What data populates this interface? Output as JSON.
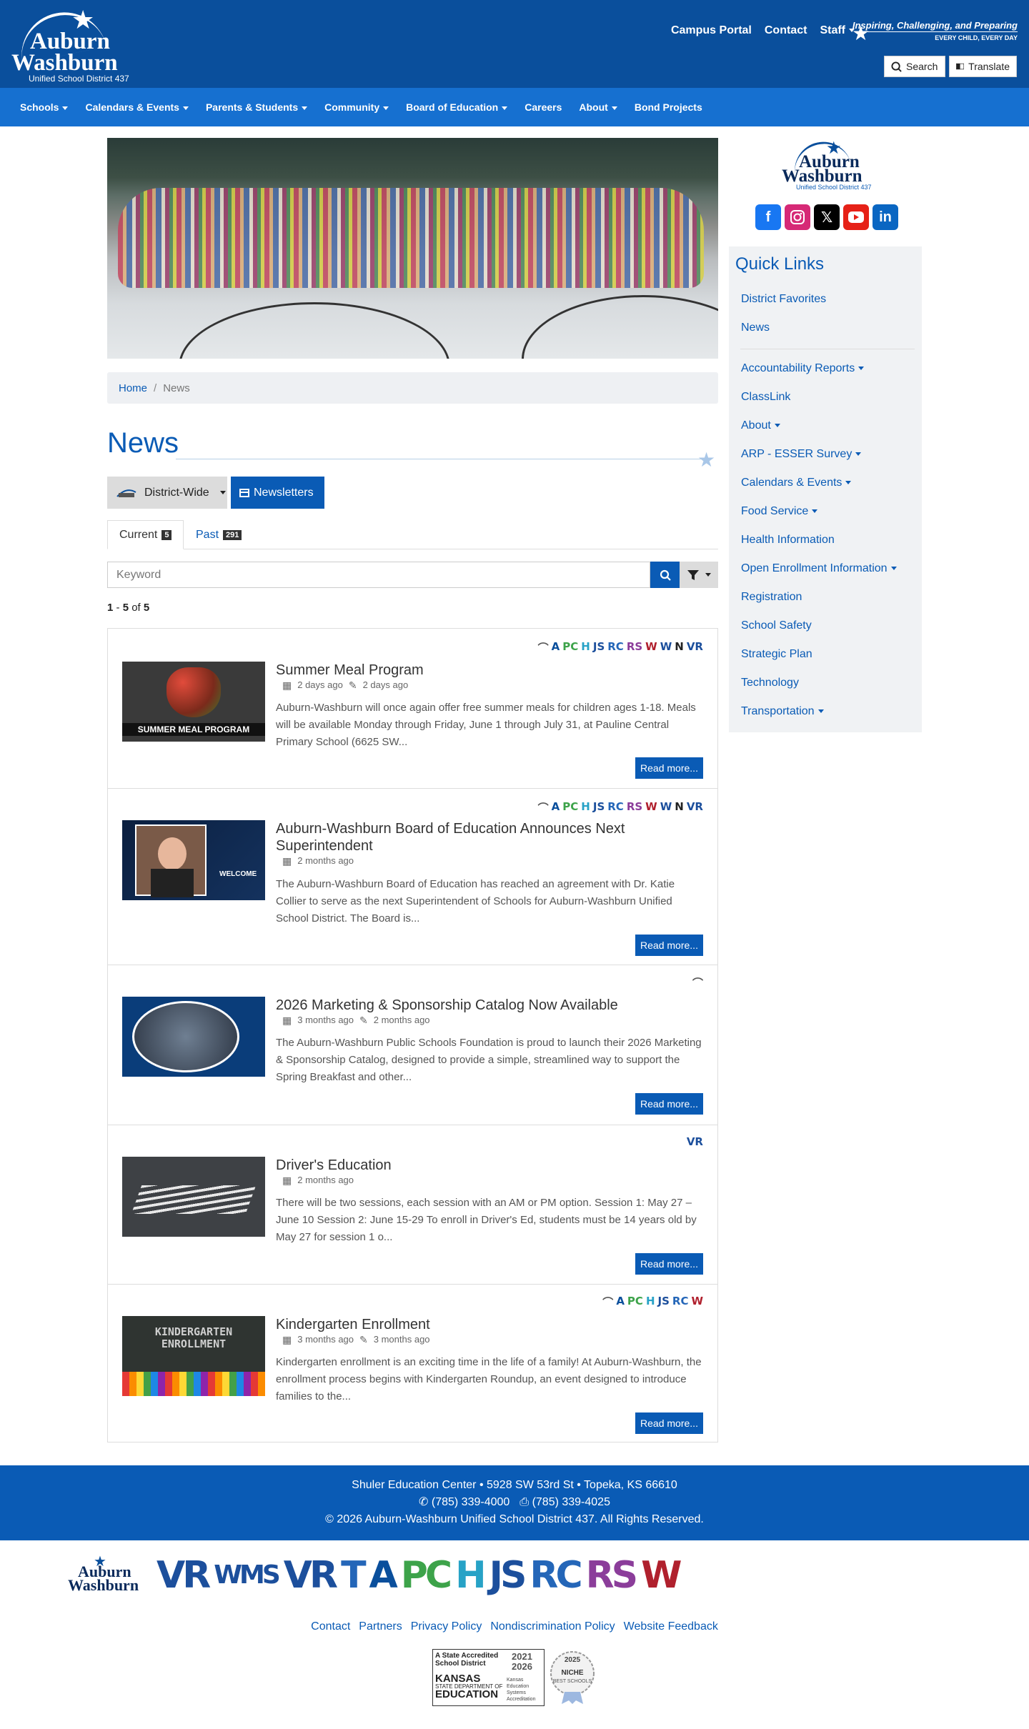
{
  "header": {
    "logo": {
      "line1": "Auburn",
      "line2": "Washburn",
      "line3": "Unified School District 437"
    },
    "top_links": [
      "Campus Portal",
      "Contact",
      "Staff"
    ],
    "tagline1": "Inspiring, Challenging, and Preparing",
    "tagline2": "EVERY CHILD, EVERY DAY",
    "search_label": "Search",
    "translate_label": "Translate"
  },
  "nav": [
    "Schools",
    "Calendars & Events",
    "Parents & Students",
    "Community",
    "Board of Education",
    "Careers",
    "About",
    "Bond Projects"
  ],
  "breadcrumb": {
    "home": "Home",
    "sep": "/",
    "current": "News"
  },
  "page_title": "News",
  "filter": {
    "district_label": "District-Wide",
    "newsletters_label": "Newsletters"
  },
  "tabs": {
    "current_label": "Current",
    "current_count": "5",
    "past_label": "Past",
    "past_count": "291"
  },
  "search": {
    "placeholder": "Keyword"
  },
  "results": {
    "from": "1",
    "dash": "-",
    "to": "5",
    "of": "of",
    "total": "5"
  },
  "articles": [
    {
      "title": "Summer Meal Program",
      "published": "2 days ago",
      "updated": "2 days ago",
      "excerpt": "Auburn-Washburn will once again offer free summer meals for children ages 1-18. Meals will be available Monday through Friday, June 1 through July 31, at Pauline Central Primary School (6625 SW...",
      "read_more": "Read more...",
      "thumb_caption": "SUMMER MEAL PROGRAM"
    },
    {
      "title": "Auburn-Washburn Board of Education Announces Next Superintendent",
      "published": "2 months ago",
      "updated": "",
      "excerpt": "The Auburn-Washburn Board of Education has reached an agreement with Dr. Katie Collier to serve as the next Superintendent of Schools for Auburn-Washburn Unified School District. The Board is...",
      "read_more": "Read more...",
      "thumb_caption": "WELCOME"
    },
    {
      "title": "2026 Marketing & Sponsorship Catalog Now Available",
      "published": "3 months ago",
      "updated": "2 months ago",
      "excerpt": "The Auburn-Washburn Public Schools Foundation is proud to launch their 2026 Marketing & Sponsorship Catalog, designed to provide a simple, streamlined way to support the Spring Breakfast and other...",
      "read_more": "Read more...",
      "thumb_caption": ""
    },
    {
      "title": "Driver's Education",
      "published": "2 months ago",
      "updated": "",
      "excerpt": "There will be two sessions, each session with an AM or PM option. Session 1: May 27 – June 10 Session 2: June 15-29 To enroll in Driver's Ed, students must be 14 years old by May 27 for session 1 o...",
      "read_more": "Read more...",
      "thumb_caption": ""
    },
    {
      "title": "Kindergarten Enrollment",
      "published": "3 months ago",
      "updated": "3 months ago",
      "excerpt": "Kindergarten enrollment is an exciting time in the life of a family! At Auburn-Washburn, the enrollment process begins with Kindergarten Roundup, an event designed to introduce families to the...",
      "read_more": "Read more...",
      "thumb_caption": "KINDERGARTEN ENROLLMENT"
    }
  ],
  "sidebar": {
    "logo": {
      "line1": "Auburn",
      "line2": "Washburn",
      "line3": "Unified School District 437"
    },
    "quick_links_title": "Quick Links",
    "links_top": [
      "District Favorites",
      "News"
    ],
    "links": [
      "Accountability Reports",
      "ClassLink",
      "About",
      "ARP - ESSER Survey",
      "Calendars & Events",
      "Food Service",
      "Health Information",
      "Open Enrollment Information",
      "Registration",
      "School Safety",
      "Strategic Plan",
      "Technology",
      "Transportation"
    ]
  },
  "footer": {
    "address": "Shuler Education Center • 5928 SW 53rd St • Topeka, KS 66610",
    "phone": "(785) 339-4000",
    "fax": "(785) 339-4025",
    "copyright": "© 2026 Auburn-Washburn Unified School District 437. All Rights Reserved.",
    "links": [
      "Contact",
      "Partners",
      "Privacy Policy",
      "Nondiscrimination Policy",
      "Website Feedback"
    ],
    "accreditation": {
      "line1": "A State Accredited",
      "line2": "School District",
      "years": "2021 2026",
      "kansas": "KANSAS",
      "dept": "STATE DEPARTMENT OF",
      "education": "EDUCATION",
      "kesa": "Kansas Education Systems Accreditation"
    },
    "niche": {
      "year": "2025",
      "label": "NICHE",
      "sub": "BEST SCHOOLS"
    }
  },
  "colors": {
    "brand": "#0a4f9c",
    "nav": "#1670d0",
    "link": "#0a5bb5"
  }
}
